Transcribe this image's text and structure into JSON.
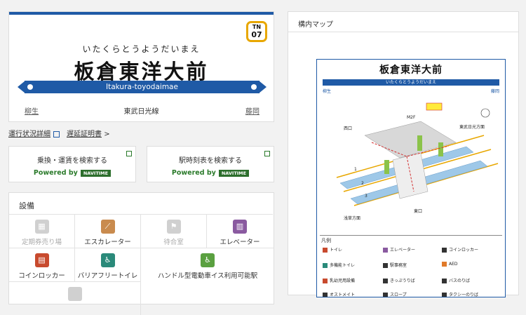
{
  "station": {
    "name_kana": "いたくらとうようだいまえ",
    "name": "板倉東洋大前",
    "number_line": "TN",
    "number": "07",
    "romaji": "Itakura-toyodaimae",
    "prev": "柳生",
    "line": "東武日光線",
    "next": "藤岡"
  },
  "links": {
    "status": "運行状況詳細",
    "delay_cert": "遅延証明書",
    "delay_arrow": ">"
  },
  "search": {
    "transfer_title": "乗換・運賃を検索する",
    "timetable_title": "駅時刻表を検索する",
    "powered_by": "Powered by",
    "navitime": "NAVITIME"
  },
  "facilities": {
    "title": "設備",
    "items": [
      {
        "label": "定期券売り場",
        "icon": "ticket-icon",
        "color": "#d0d0d0",
        "available": false
      },
      {
        "label": "エスカレーター",
        "icon": "escalator-icon",
        "color": "#c98b4e",
        "available": true
      },
      {
        "label": "待合室",
        "icon": "waiting-room-icon",
        "color": "#d0d0d0",
        "available": false
      },
      {
        "label": "エレベーター",
        "icon": "elevator-icon",
        "color": "#8a5aa0",
        "available": true
      },
      {
        "label": "コインロッカー",
        "icon": "coin-locker-icon",
        "color": "#c84a2e",
        "available": true
      },
      {
        "label": "バリアフリートイレ",
        "icon": "accessible-toilet-icon",
        "color": "#2a8a7a",
        "available": true
      },
      {
        "label": "ハンドル型電動車イス利用可能駅",
        "icon": "wheelchair-icon",
        "color": "#5aa040",
        "available": true
      }
    ]
  },
  "map": {
    "header": "構内マップ",
    "title": "板倉東洋大前",
    "kana": "いたくらとうようだいまえ",
    "prev": "柳生",
    "next": "藤岡",
    "legend_title": "凡例",
    "legend": [
      {
        "label": "トイレ",
        "color": "#c84a2e"
      },
      {
        "label": "エレベーター",
        "color": "#8a5aa0"
      },
      {
        "label": "コインロッカー",
        "color": "#333333"
      },
      {
        "label": "多機能トイレ",
        "color": "#2a8a7a"
      },
      {
        "label": "駅事務室",
        "color": "#333333"
      },
      {
        "label": "AED",
        "color": "#e07a2a"
      },
      {
        "label": "乳幼児用設備",
        "color": "#c84a2e"
      },
      {
        "label": "きっぷうりば",
        "color": "#333333"
      },
      {
        "label": "バスのりば",
        "color": "#333333"
      },
      {
        "label": "オストメイト",
        "color": "#333333"
      },
      {
        "label": "スロープ",
        "color": "#333333"
      },
      {
        "label": "タクシーのりば",
        "color": "#333333"
      }
    ]
  },
  "colors": {
    "line_blue": "#1f5aa6",
    "number_badge": "#e8a700",
    "navitime_green": "#2c6e2c"
  }
}
